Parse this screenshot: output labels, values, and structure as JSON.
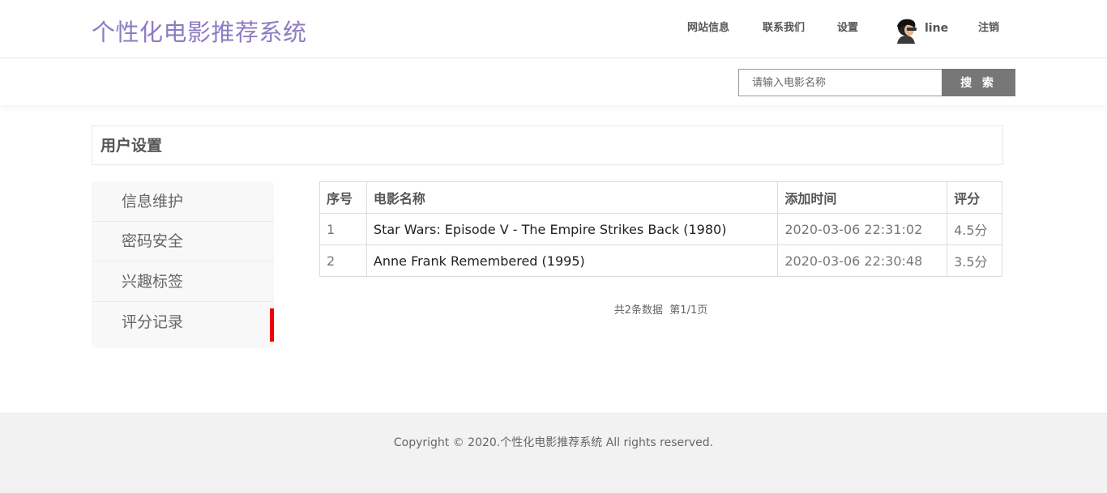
{
  "header": {
    "brand": "个性化电影推荐系统",
    "nav": {
      "site_info": "网站信息",
      "contact": "联系我们",
      "settings": "设置",
      "username": "line",
      "logout": "注销"
    }
  },
  "search": {
    "placeholder": "请输入电影名称",
    "button": "搜 索"
  },
  "section_title": "用户设置",
  "menu": {
    "items": [
      {
        "label": "信息维护"
      },
      {
        "label": "密码安全"
      },
      {
        "label": "兴趣标签"
      },
      {
        "label": "评分记录",
        "active": true
      }
    ],
    "active_color": "#e00000"
  },
  "table": {
    "headers": [
      "序号",
      "电影名称",
      "添加时间",
      "评分"
    ],
    "rows": [
      [
        "1",
        "Star Wars: Episode V - The Empire Strikes Back (1980)",
        "2020-03-06 22:31:02",
        "4.5分"
      ],
      [
        "2",
        "Anne Frank Remembered (1995)",
        "2020-03-06 22:30:48",
        "3.5分"
      ]
    ]
  },
  "pager": "共2条数据  第1/1页",
  "footer": {
    "copyright": "Copyright © 2020.个性化电影推荐系统 All rights reserved."
  },
  "colors": {
    "brand": "#8e7cc3",
    "search_button": "#777777"
  }
}
